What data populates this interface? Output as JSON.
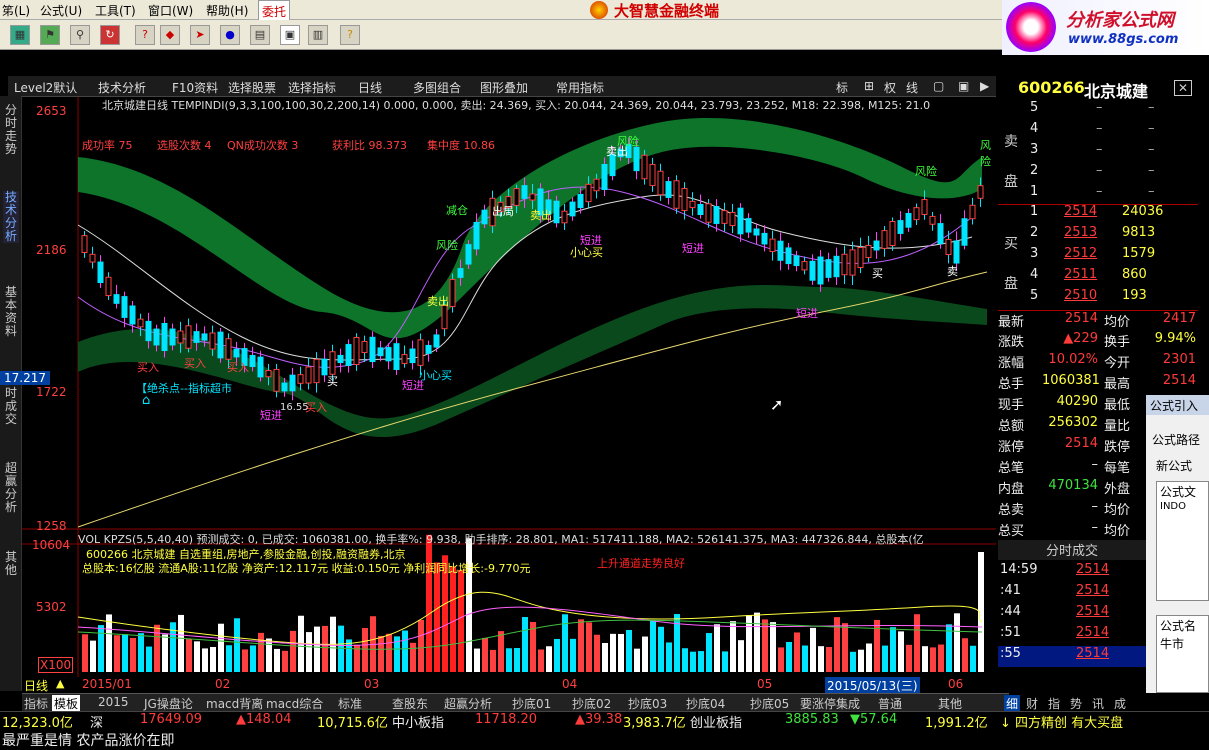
{
  "menu": {
    "items": [
      "笫(L)",
      "公式(U)",
      "工具(T)",
      "窗口(W)",
      "帮助(H)"
    ],
    "active": "委托",
    "brand": "大智慧金融终端"
  },
  "ad": {
    "title": "分析家公式网",
    "url": "www.88gs.com"
  },
  "tabs": {
    "items": [
      "Level2默认",
      "技术分析",
      "F10资料",
      "选择股票",
      "选择指标",
      "日线",
      "多图组合",
      "图形叠加",
      "常用指标"
    ],
    "right": [
      "标",
      "权",
      "线"
    ]
  },
  "left_tabs": [
    "分时走势",
    "技术分析",
    "基本资料",
    "分时成交",
    "超赢分析",
    "其他"
  ],
  "chart": {
    "header": "北京城建日线 TEMPINDI(9,3,3,100,100,30,2,200,14) 0.000, 0.000, 卖出: 24.369, 买入: 20.044, 24.369, 20.044, 23.793, 23.252, M18: 22.398, M125: 21.0",
    "stats": {
      "success": "成功率 75",
      "picks": "选股次数 4",
      "qn": "QN成功次数 3",
      "profit": "获利比 98.373",
      "conc": "集中度 10.86"
    },
    "y_labels": [
      "2653",
      "2186",
      "1722",
      "1258"
    ],
    "cursor_price": "17.217",
    "annotations": [
      "买入",
      "买入",
      "买入",
      "卖出",
      "风险",
      "减仓",
      "出局",
      "卖出",
      "风险",
      "卖出",
      "短进",
      "小心买",
      "短进",
      "短进",
      "风险",
      "短进",
      "买入",
      "小心买",
      "买",
      "买",
      "卖",
      "风险",
      "短进",
      "16.55",
      "【绝杀点--指标超市"
    ],
    "vol_header": "VOL KPZS(5,5,40,40) 预测成交: 0, 已成交: 1060381.00, 换手率%: 9.938, 助手排序: 28.801, MA1: 517411.188, MA2: 526141.375, MA3: 447326.844, 总股本(亿",
    "vol_info1": "600266 北京城建 自选重组,房地产,参股金融,创投,融资融券,北京",
    "vol_info2": "总股本:16亿股 流通A股:11亿股 净资产:12.117元 收益:0.150元 净利润同比增长:-9.770元",
    "vol_note": "上升通道走势良好",
    "vol_labels": [
      "10604",
      "5302",
      "X100"
    ],
    "x_labels": [
      "2015/01",
      "02",
      "03",
      "04",
      "05",
      "06"
    ],
    "cursor_date": "2015/05/13(三)",
    "period": "日线"
  },
  "quote": {
    "code": "600266",
    "name": "北京城建",
    "sell": [
      {
        "n": "5",
        "p": "–",
        "v": "–"
      },
      {
        "n": "4",
        "p": "–",
        "v": "–"
      },
      {
        "n": "3",
        "p": "–",
        "v": "–"
      },
      {
        "n": "2",
        "p": "–",
        "v": "–"
      },
      {
        "n": "1",
        "p": "–",
        "v": "–"
      }
    ],
    "buy": [
      {
        "n": "1",
        "p": "2514",
        "v": "24036"
      },
      {
        "n": "2",
        "p": "2513",
        "v": "9813"
      },
      {
        "n": "3",
        "p": "2512",
        "v": "1579"
      },
      {
        "n": "4",
        "p": "2511",
        "v": "860"
      },
      {
        "n": "5",
        "p": "2510",
        "v": "193"
      }
    ],
    "sell_label": "卖盘",
    "buy_label": "买盘",
    "rows": [
      {
        "l1": "最新",
        "v1": "2514",
        "l2": "均价",
        "v2": "2417"
      },
      {
        "l1": "涨跌",
        "v1": "▲229",
        "l2": "换手",
        "v2": "9.94%"
      },
      {
        "l1": "涨幅",
        "v1": "10.02%",
        "l2": "今开",
        "v2": "2301"
      },
      {
        "l1": "总手",
        "v1": "1060381",
        "l2": "最高",
        "v2": "2514"
      },
      {
        "l1": "现手",
        "v1": "40290",
        "l2": "最低",
        "v2": ""
      },
      {
        "l1": "总额",
        "v1": "256302",
        "l2": "量比",
        "v2": ""
      },
      {
        "l1": "涨停",
        "v1": "2514",
        "l2": "跌停",
        "v2": ""
      },
      {
        "l1": "总笔",
        "v1": "–",
        "l2": "每笔",
        "v2": ""
      },
      {
        "l1": "内盘",
        "v1": "470134",
        "l2": "外盘",
        "v2": ""
      },
      {
        "l1": "总卖",
        "v1": "–",
        "l2": "均价",
        "v2": ""
      },
      {
        "l1": "总买",
        "v1": "–",
        "l2": "均价",
        "v2": ""
      }
    ],
    "ticks_title": "分时成交",
    "ticks": [
      {
        "t": "14:59",
        "p": "2514"
      },
      {
        "t": ":41",
        "p": "2514"
      },
      {
        "t": ":44",
        "p": "2514"
      },
      {
        "t": ":51",
        "p": "2514"
      },
      {
        "t": ":55",
        "p": "2514"
      }
    ]
  },
  "formula_panel": {
    "title": "公式引入",
    "path": "公式路径",
    "new": "新公式",
    "list1": "公式文",
    "item1": "INDO",
    "list2": "公式名",
    "item2": "牛市"
  },
  "bottom_tabs": [
    "指标",
    "模板",
    "2015",
    "JG操盘论",
    "macd背离",
    "macd综合",
    "标准",
    "查股东",
    "超赢分析",
    "抄底01",
    "抄底02",
    "抄底03",
    "抄底04",
    "抄底05",
    "要涨停集成",
    "普通",
    "其他"
  ],
  "bottom_right": [
    "细",
    "财",
    "指",
    "势",
    "讯",
    "成"
  ],
  "status": {
    "sh_amt": "12,323.0亿",
    "sz": "深",
    "sz_idx": "17649.09",
    "sz_chg": "▲148.04",
    "sz_amt": "10,715.6亿",
    "zxb": "中小板指",
    "zxb_idx": "11718.20",
    "zxb_chg": "▲39.38",
    "zxb_amt": "3,983.7亿",
    "cyb": "创业板指",
    "cyb_idx": "3885.83",
    "cyb_chg": "▼57.64",
    "cyb_amt": "1,991.2亿",
    "news": "↓ 四方精创 有大买盘",
    "marquee": "最严重是情 农产品涨价在即"
  }
}
